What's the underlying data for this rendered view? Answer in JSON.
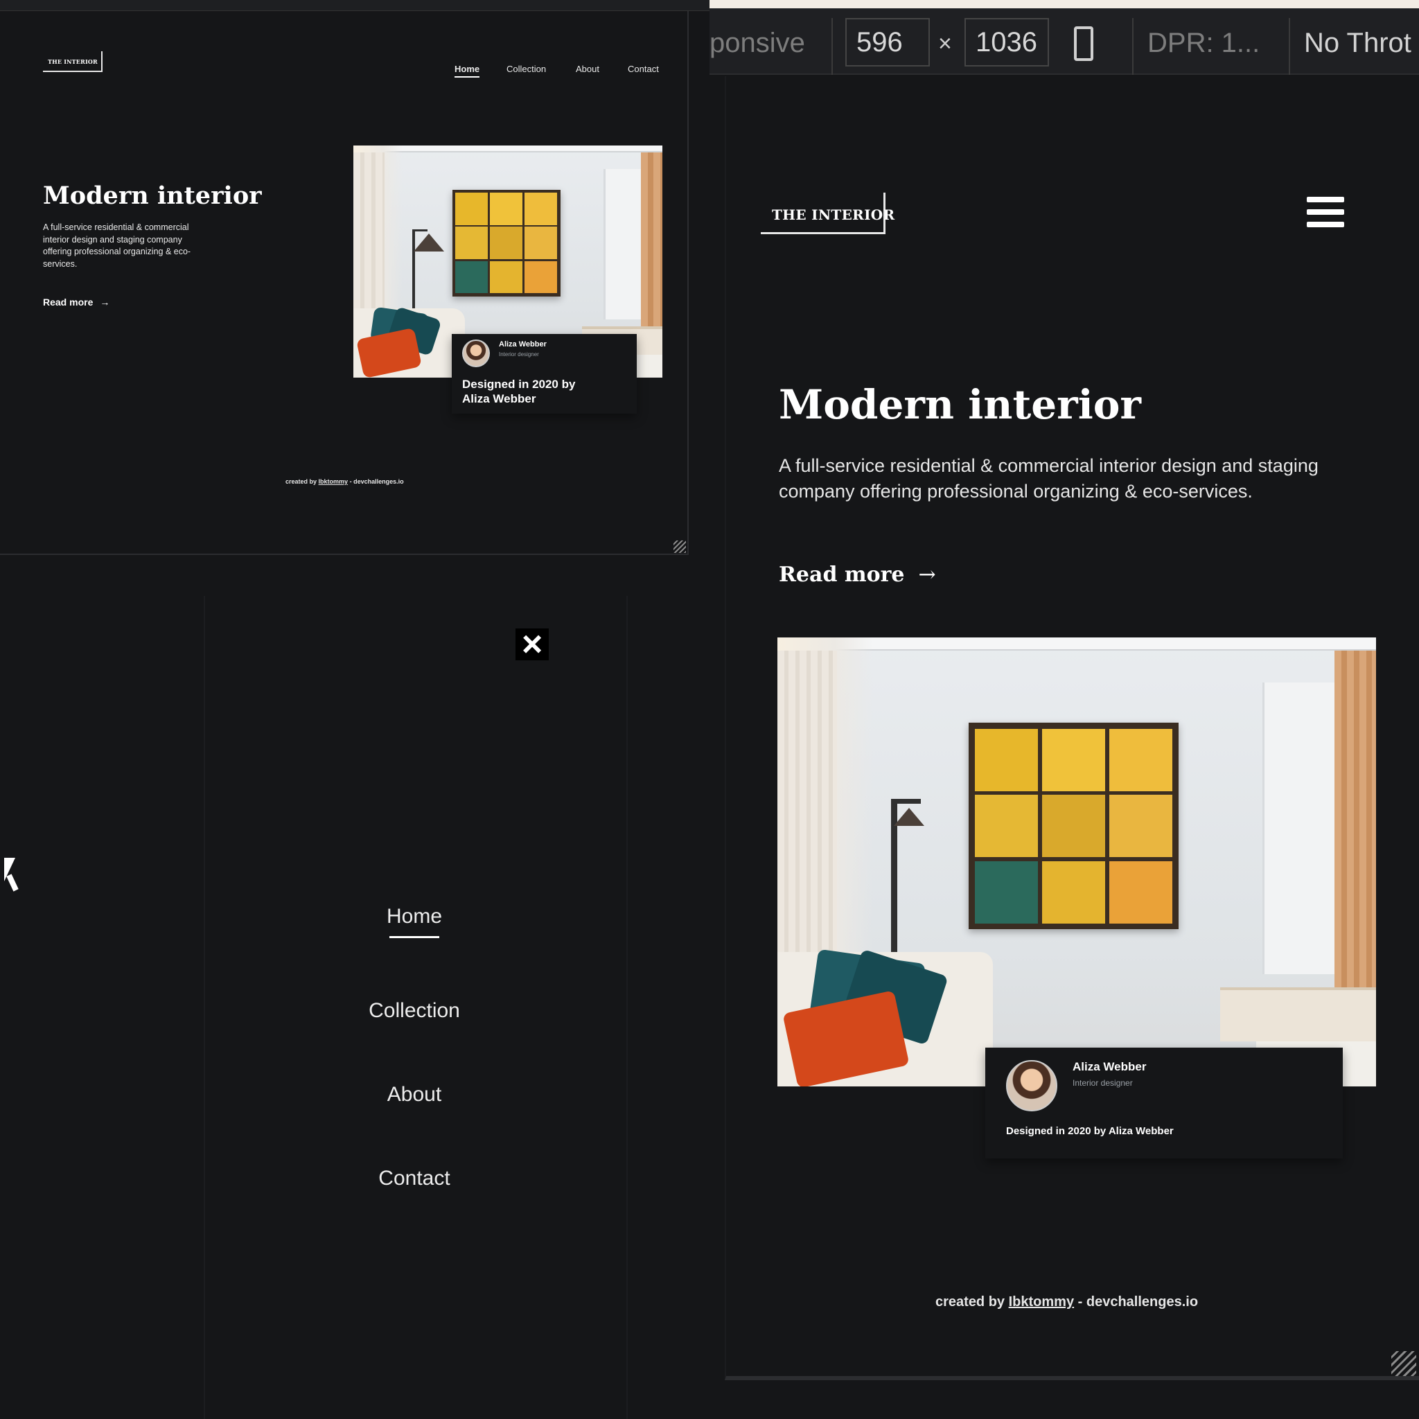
{
  "brand": {
    "logo": "THE INTERIOR"
  },
  "nav": {
    "items": [
      "Home",
      "Collection",
      "About",
      "Contact"
    ],
    "active": "Home"
  },
  "hero": {
    "title": "Modern interior",
    "description": "A full-service residential & commercial interior design and staging company offering professional organizing & eco-services.",
    "read_more": "Read more",
    "arrow": "→"
  },
  "designer_card": {
    "name": "Aliza Webber",
    "role": "Interior designer",
    "designed": "Designed in 2020 by Aliza Webber"
  },
  "footer": {
    "prefix": "created by",
    "author": "Ibktommy",
    "suffix": "- devchallenges.io"
  },
  "menu": {
    "close_icon": "×"
  },
  "devtools": {
    "device": "ponsive",
    "width": "596",
    "times": "×",
    "height": "1036",
    "dpr": "DPR: 1...",
    "throttle": "No Throt"
  },
  "artwork_colors": [
    "#e7b72b",
    "#f0c23a",
    "#efbd3c",
    "#e5b834",
    "#d9a92c",
    "#e9b640",
    "#2b6a5c",
    "#e4b42f",
    "#eaa238"
  ]
}
